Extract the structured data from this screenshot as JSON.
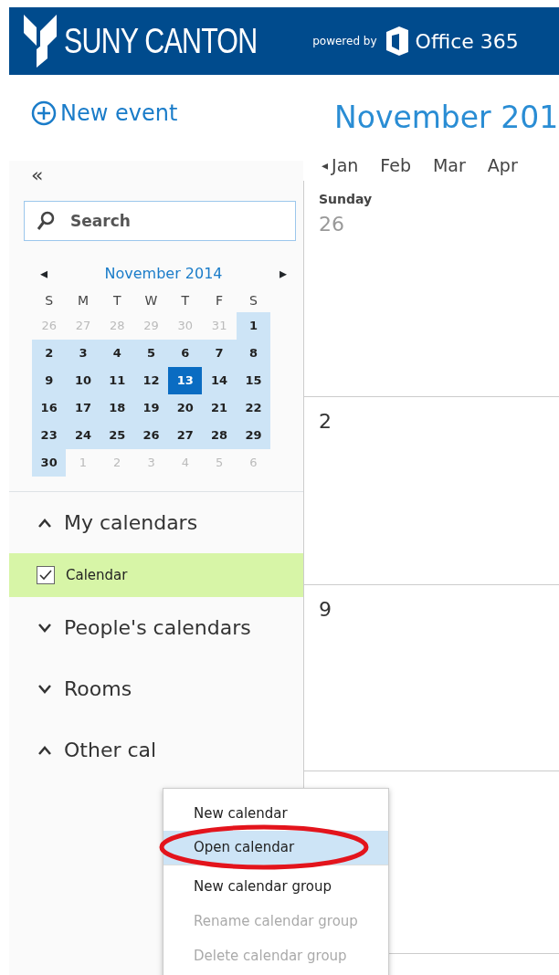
{
  "header": {
    "brand": "SUNY CANTON",
    "powered_by": "powered by",
    "product": "Office 365"
  },
  "new_event": "New event",
  "collapse": "«",
  "search": {
    "placeholder": "Search"
  },
  "mini_calendar": {
    "prev": "◂",
    "next": "▸",
    "title": "November 2014",
    "weekdays": [
      "S",
      "M",
      "T",
      "W",
      "T",
      "F",
      "S"
    ],
    "days": [
      {
        "label": "26",
        "kind": "other"
      },
      {
        "label": "27",
        "kind": "other"
      },
      {
        "label": "28",
        "kind": "other"
      },
      {
        "label": "29",
        "kind": "other"
      },
      {
        "label": "30",
        "kind": "other"
      },
      {
        "label": "31",
        "kind": "other"
      },
      {
        "label": "1",
        "kind": "range"
      },
      {
        "label": "2",
        "kind": "range"
      },
      {
        "label": "3",
        "kind": "range"
      },
      {
        "label": "4",
        "kind": "range"
      },
      {
        "label": "5",
        "kind": "range"
      },
      {
        "label": "6",
        "kind": "range"
      },
      {
        "label": "7",
        "kind": "range"
      },
      {
        "label": "8",
        "kind": "range"
      },
      {
        "label": "9",
        "kind": "range"
      },
      {
        "label": "10",
        "kind": "range"
      },
      {
        "label": "11",
        "kind": "range"
      },
      {
        "label": "12",
        "kind": "range"
      },
      {
        "label": "13",
        "kind": "today"
      },
      {
        "label": "14",
        "kind": "range"
      },
      {
        "label": "15",
        "kind": "range"
      },
      {
        "label": "16",
        "kind": "range"
      },
      {
        "label": "17",
        "kind": "range"
      },
      {
        "label": "18",
        "kind": "range"
      },
      {
        "label": "19",
        "kind": "range"
      },
      {
        "label": "20",
        "kind": "range"
      },
      {
        "label": "21",
        "kind": "range"
      },
      {
        "label": "22",
        "kind": "range"
      },
      {
        "label": "23",
        "kind": "range"
      },
      {
        "label": "24",
        "kind": "range"
      },
      {
        "label": "25",
        "kind": "range"
      },
      {
        "label": "26",
        "kind": "range"
      },
      {
        "label": "27",
        "kind": "range"
      },
      {
        "label": "28",
        "kind": "range"
      },
      {
        "label": "29",
        "kind": "range"
      },
      {
        "label": "30",
        "kind": "range"
      },
      {
        "label": "1",
        "kind": "other"
      },
      {
        "label": "2",
        "kind": "other"
      },
      {
        "label": "3",
        "kind": "other"
      },
      {
        "label": "4",
        "kind": "other"
      },
      {
        "label": "5",
        "kind": "other"
      },
      {
        "label": "6",
        "kind": "other"
      }
    ]
  },
  "calendar_list": [
    {
      "kind": "group",
      "label": "My calendars",
      "expanded": true
    },
    {
      "kind": "calendar",
      "label": "Calendar",
      "checked": true,
      "selected": true
    },
    {
      "kind": "group",
      "label": "People's calendars",
      "expanded": false
    },
    {
      "kind": "group",
      "label": "Rooms",
      "expanded": false
    },
    {
      "kind": "group",
      "label": "Other cal",
      "expanded": true
    }
  ],
  "main": {
    "title": "November 201",
    "months_prev": "◂",
    "months": [
      "Jan",
      "Feb",
      "Mar",
      "Apr"
    ],
    "day_header": "Sunday",
    "weeks": [
      {
        "date": "26",
        "muted": true
      },
      {
        "date": "2",
        "muted": false
      },
      {
        "date": "9",
        "muted": false
      }
    ]
  },
  "context_menu": [
    {
      "label": "New calendar",
      "selected": false,
      "disabled": false,
      "separator_after": false,
      "circled": false
    },
    {
      "label": "Open calendar",
      "selected": true,
      "disabled": false,
      "separator_after": true,
      "circled": true
    },
    {
      "label": "New calendar group",
      "selected": false,
      "disabled": false,
      "separator_after": false,
      "circled": false
    },
    {
      "label": "Rename calendar group",
      "selected": false,
      "disabled": true,
      "separator_after": false,
      "circled": false
    },
    {
      "label": "Delete calendar group",
      "selected": false,
      "disabled": true,
      "separator_after": false,
      "circled": false
    }
  ]
}
